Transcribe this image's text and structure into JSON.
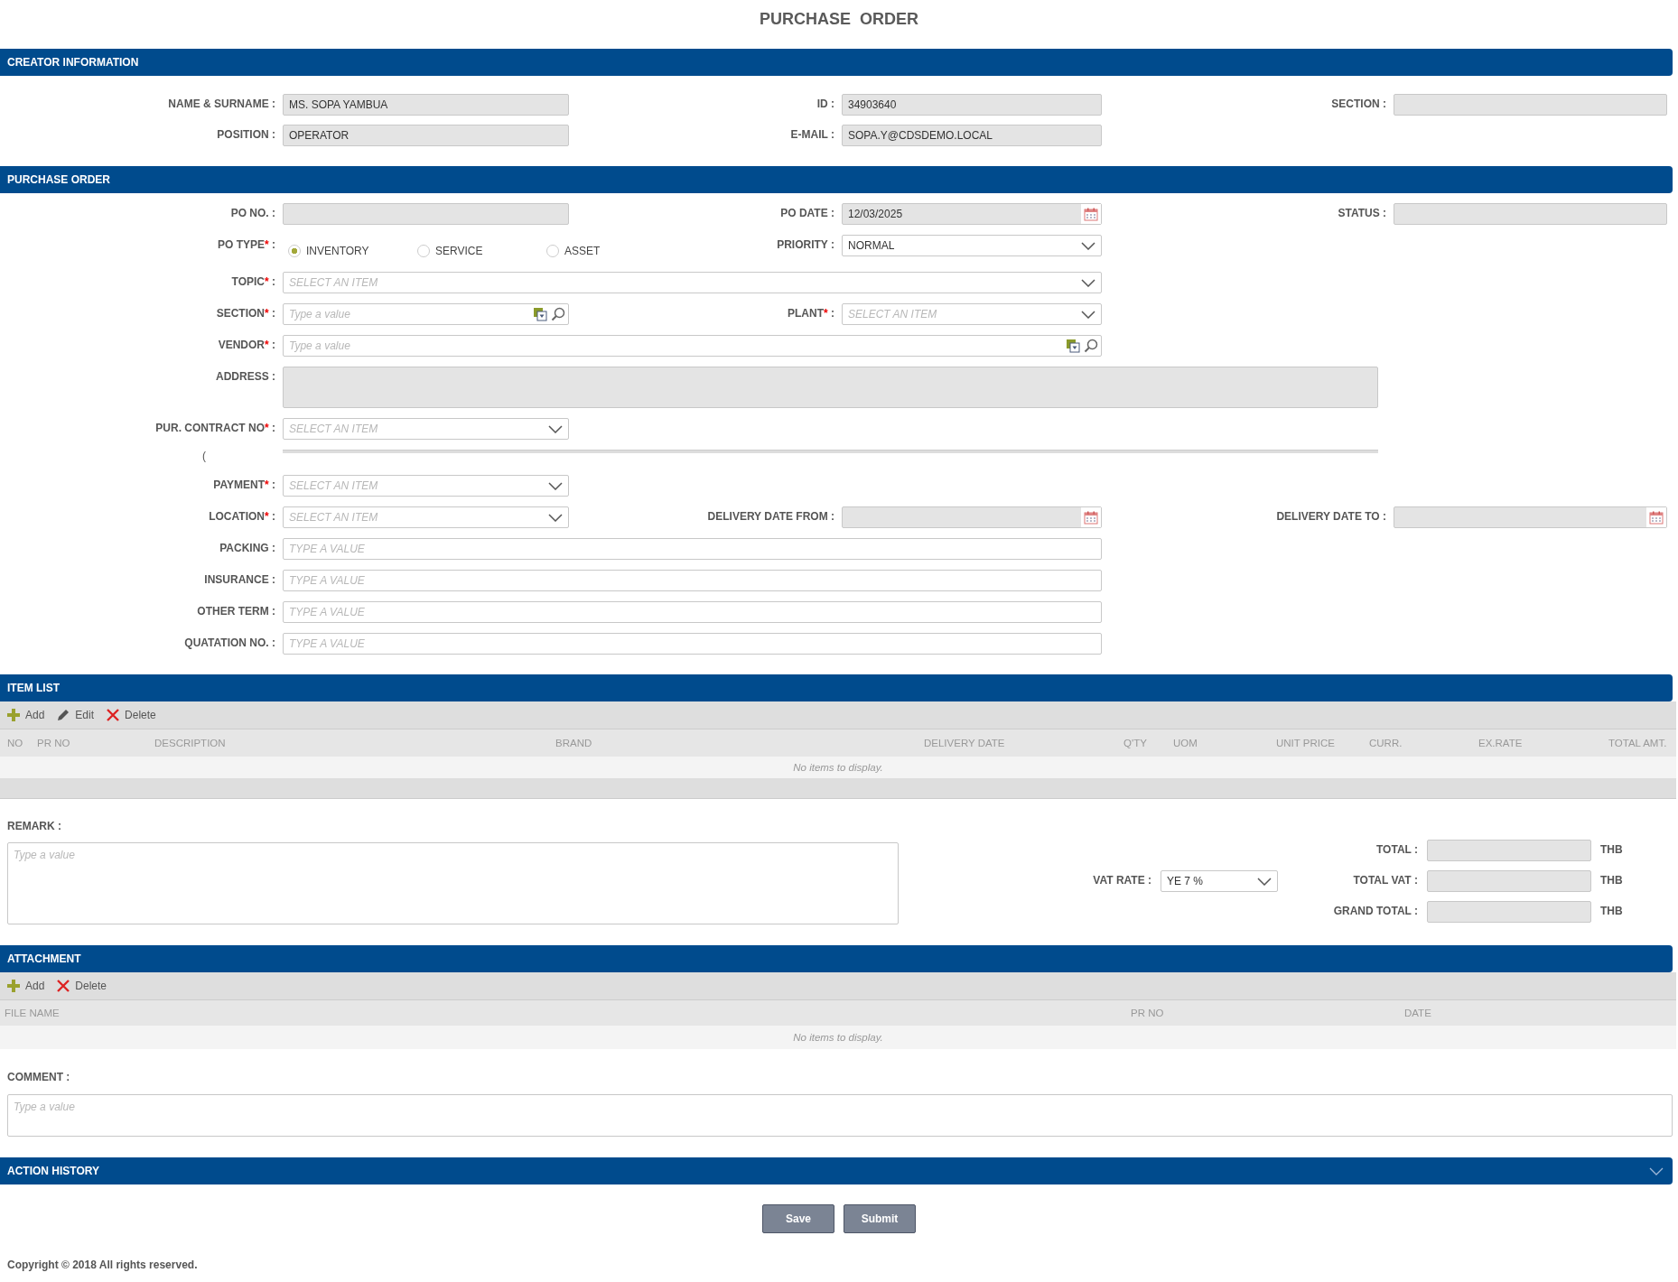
{
  "title": "PURCHASE  ORDER",
  "creator": {
    "header": "CREATOR INFORMATION",
    "fields": [
      {
        "label": "NAME & SURNAME :",
        "kind": "readonly",
        "value": "MS. SOPA YAMBUA"
      },
      {
        "label": "ID :",
        "kind": "readonly",
        "value": "34903640"
      },
      {
        "label": "SECTION :",
        "kind": "readonly"
      },
      {
        "label": "POSITION :",
        "kind": "readonly",
        "value": "OPERATOR"
      },
      {
        "label": "E-MAIL :",
        "kind": "readonly",
        "value": "SOPA.Y@CDSDEMO.LOCAL"
      }
    ]
  },
  "purchase_order": {
    "header": "PURCHASE ORDER",
    "fields": [
      {
        "label": "PO NO. :",
        "kind": "readonly"
      },
      {
        "label": "PO DATE :",
        "kind": "date",
        "value": "12/03/2025"
      },
      {
        "label": "STATUS :",
        "kind": "readonly"
      },
      {
        "label": "PO TYPE",
        "required_mark": "*",
        "label_end": ":",
        "kind": "radio",
        "options": [
          {
            "label": "INVENTORY",
            "selected": true
          },
          {
            "label": "SERVICE",
            "selected": false
          },
          {
            "label": "ASSET",
            "selected": false
          }
        ]
      },
      {
        "label": "PRIORITY :",
        "kind": "select",
        "value": "NORMAL"
      },
      {
        "label": "TOPIC",
        "required_mark": "*",
        "label_end": ":",
        "kind": "select",
        "placeholder": "SELECT AN ITEM"
      },
      {
        "label": "SECTION",
        "required_mark": "*",
        "label_end": ":",
        "kind": "lookup",
        "placeholder": "Type a value"
      },
      {
        "label": "PLANT",
        "required_mark": "*",
        "label_end": ":",
        "kind": "select",
        "placeholder": "SELECT AN ITEM"
      },
      {
        "label": "VENDOR",
        "required_mark": "*",
        "label_end": ":",
        "kind": "lookup",
        "placeholder": "Type a value"
      },
      {
        "label": "ADDRESS :",
        "kind": "readonly_area"
      },
      {
        "label": "PUR. CONTRACT NO",
        "required_mark": "*",
        "label_end": ":",
        "kind": "select",
        "placeholder": "SELECT AN ITEM"
      },
      {
        "kind": "partial",
        "text": "("
      },
      {
        "label": "PAYMENT",
        "required_mark": "*",
        "label_end": ":",
        "kind": "select",
        "placeholder": "SELECT AN ITEM"
      },
      {
        "label": "LOCATION",
        "required_mark": "*",
        "label_end": ":",
        "kind": "select",
        "placeholder": "SELECT AN ITEM"
      },
      {
        "label": "DELIVERY DATE FROM :",
        "kind": "date"
      },
      {
        "label": "DELIVERY DATE TO :",
        "kind": "date"
      },
      {
        "label": "PACKING :",
        "kind": "input",
        "placeholder": "TYPE A VALUE"
      },
      {
        "label": "INSURANCE :",
        "kind": "input",
        "placeholder": "TYPE A VALUE"
      },
      {
        "label": "OTHER TERM :",
        "kind": "input",
        "placeholder": "TYPE A VALUE"
      },
      {
        "label": "QUATATION NO. :",
        "kind": "input",
        "placeholder": "TYPE A VALUE"
      }
    ]
  },
  "item_list": {
    "header": "ITEM LIST",
    "toolbar": [
      {
        "kind": "add",
        "label": "Add"
      },
      {
        "kind": "edit",
        "label": "Edit"
      },
      {
        "kind": "delete",
        "label": "Delete"
      }
    ],
    "columns": [
      "NO",
      "PR NO",
      "DESCRIPTION",
      "BRAND",
      "DELIVERY DATE",
      "Q'TY",
      "UOM",
      "UNIT PRICE",
      "CURR.",
      "EX.RATE",
      "TOTAL AMT."
    ],
    "empty_text": "No items to display."
  },
  "remark": {
    "label": "REMARK :",
    "placeholder": "Type a value"
  },
  "vat_rate": {
    "label": "VAT RATE :",
    "value": "YE 7 %"
  },
  "totals": [
    {
      "label": "TOTAL :",
      "currency": "THB"
    },
    {
      "label": "TOTAL VAT :",
      "currency": "THB"
    },
    {
      "label": "GRAND TOTAL :",
      "currency": "THB"
    }
  ],
  "attachment": {
    "header": "ATTACHMENT",
    "toolbar": [
      {
        "kind": "add",
        "label": "Add"
      },
      {
        "kind": "delete",
        "label": "Delete"
      }
    ],
    "columns": [
      "FILE NAME",
      "PR NO",
      "DATE"
    ],
    "empty_text": "No items to display."
  },
  "comment": {
    "label": "COMMENT :",
    "placeholder": "Type a value"
  },
  "action_history": {
    "header": "ACTION HISTORY",
    "expanded": false
  },
  "buttons": [
    "Save",
    "Submit"
  ],
  "copyright": "Copyright © 2018 All rights reserved."
}
